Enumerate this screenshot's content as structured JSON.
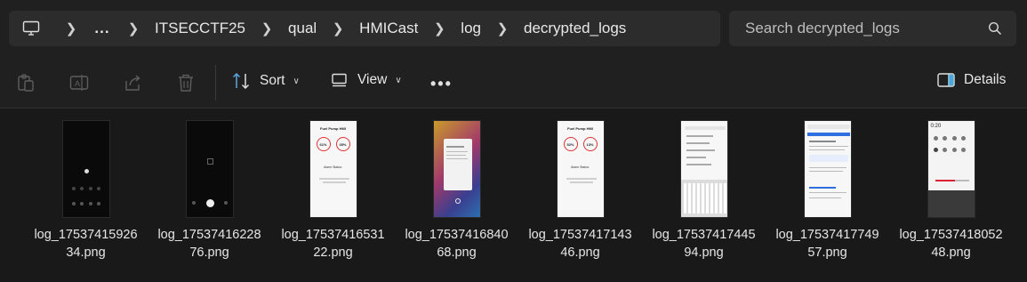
{
  "breadcrumb": {
    "overflow": "...",
    "segments": [
      "ITSECCTF25",
      "qual",
      "HMICast",
      "log",
      "decrypted_logs"
    ]
  },
  "search": {
    "placeholder": "Search decrypted_logs"
  },
  "toolbar": {
    "sort_label": "Sort",
    "view_label": "View",
    "more_label": "•••",
    "details_label": "Details"
  },
  "files": [
    {
      "line1": "log_17537415926",
      "line2": "34.png"
    },
    {
      "line1": "log_17537416228",
      "line2": "76.png"
    },
    {
      "line1": "log_17537416531",
      "line2": "22.png"
    },
    {
      "line1": "log_17537416840",
      "line2": "68.png"
    },
    {
      "line1": "log_17537417143",
      "line2": "46.png"
    },
    {
      "line1": "log_17537417445",
      "line2": "94.png"
    },
    {
      "line1": "log_17537417749",
      "line2": "57.png"
    },
    {
      "line1": "log_17537418052",
      "line2": "48.png"
    }
  ],
  "thumbs": {
    "hmi_title": "Fuel Pump HMI",
    "hmi1": {
      "pressure": "61%",
      "temperature": "35%"
    },
    "hmi2": {
      "pressure": "52%",
      "temperature": "13%"
    },
    "pressure_label": "Pressure",
    "temperature_label": "Temperature",
    "alarm_label": "Alarm Status:",
    "phone_time": "0:20"
  },
  "colors": {
    "background": "#191919",
    "bar": "#202020",
    "field": "#2c2c2c",
    "accent": "#4cc2ff"
  }
}
